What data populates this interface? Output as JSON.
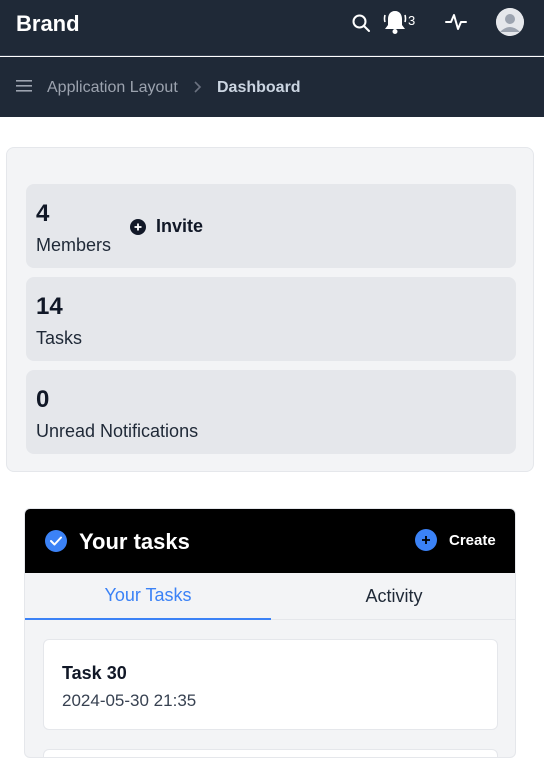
{
  "topbar": {
    "brand": "Brand",
    "notification_count": "3",
    "icons": [
      "search-icon",
      "bell-icon",
      "activity-icon",
      "user-avatar-icon"
    ]
  },
  "breadcrumb": {
    "items": [
      "Application Layout",
      "Dashboard"
    ]
  },
  "stats": [
    {
      "value": "4",
      "label": "Members",
      "action": "Invite"
    },
    {
      "value": "14",
      "label": "Tasks"
    },
    {
      "value": "0",
      "label": "Unread Notifications"
    }
  ],
  "tasks_panel": {
    "title": "Your tasks",
    "create_label": "Create",
    "tabs": [
      {
        "label": "Your Tasks",
        "active": true
      },
      {
        "label": "Activity",
        "active": false
      }
    ],
    "items": [
      {
        "name": "Task 30",
        "date": "2024-05-30 21:35"
      }
    ]
  },
  "colors": {
    "topbar_bg": "#1f2937",
    "accent": "#3b82f6",
    "panel_header_bg": "#000000"
  }
}
